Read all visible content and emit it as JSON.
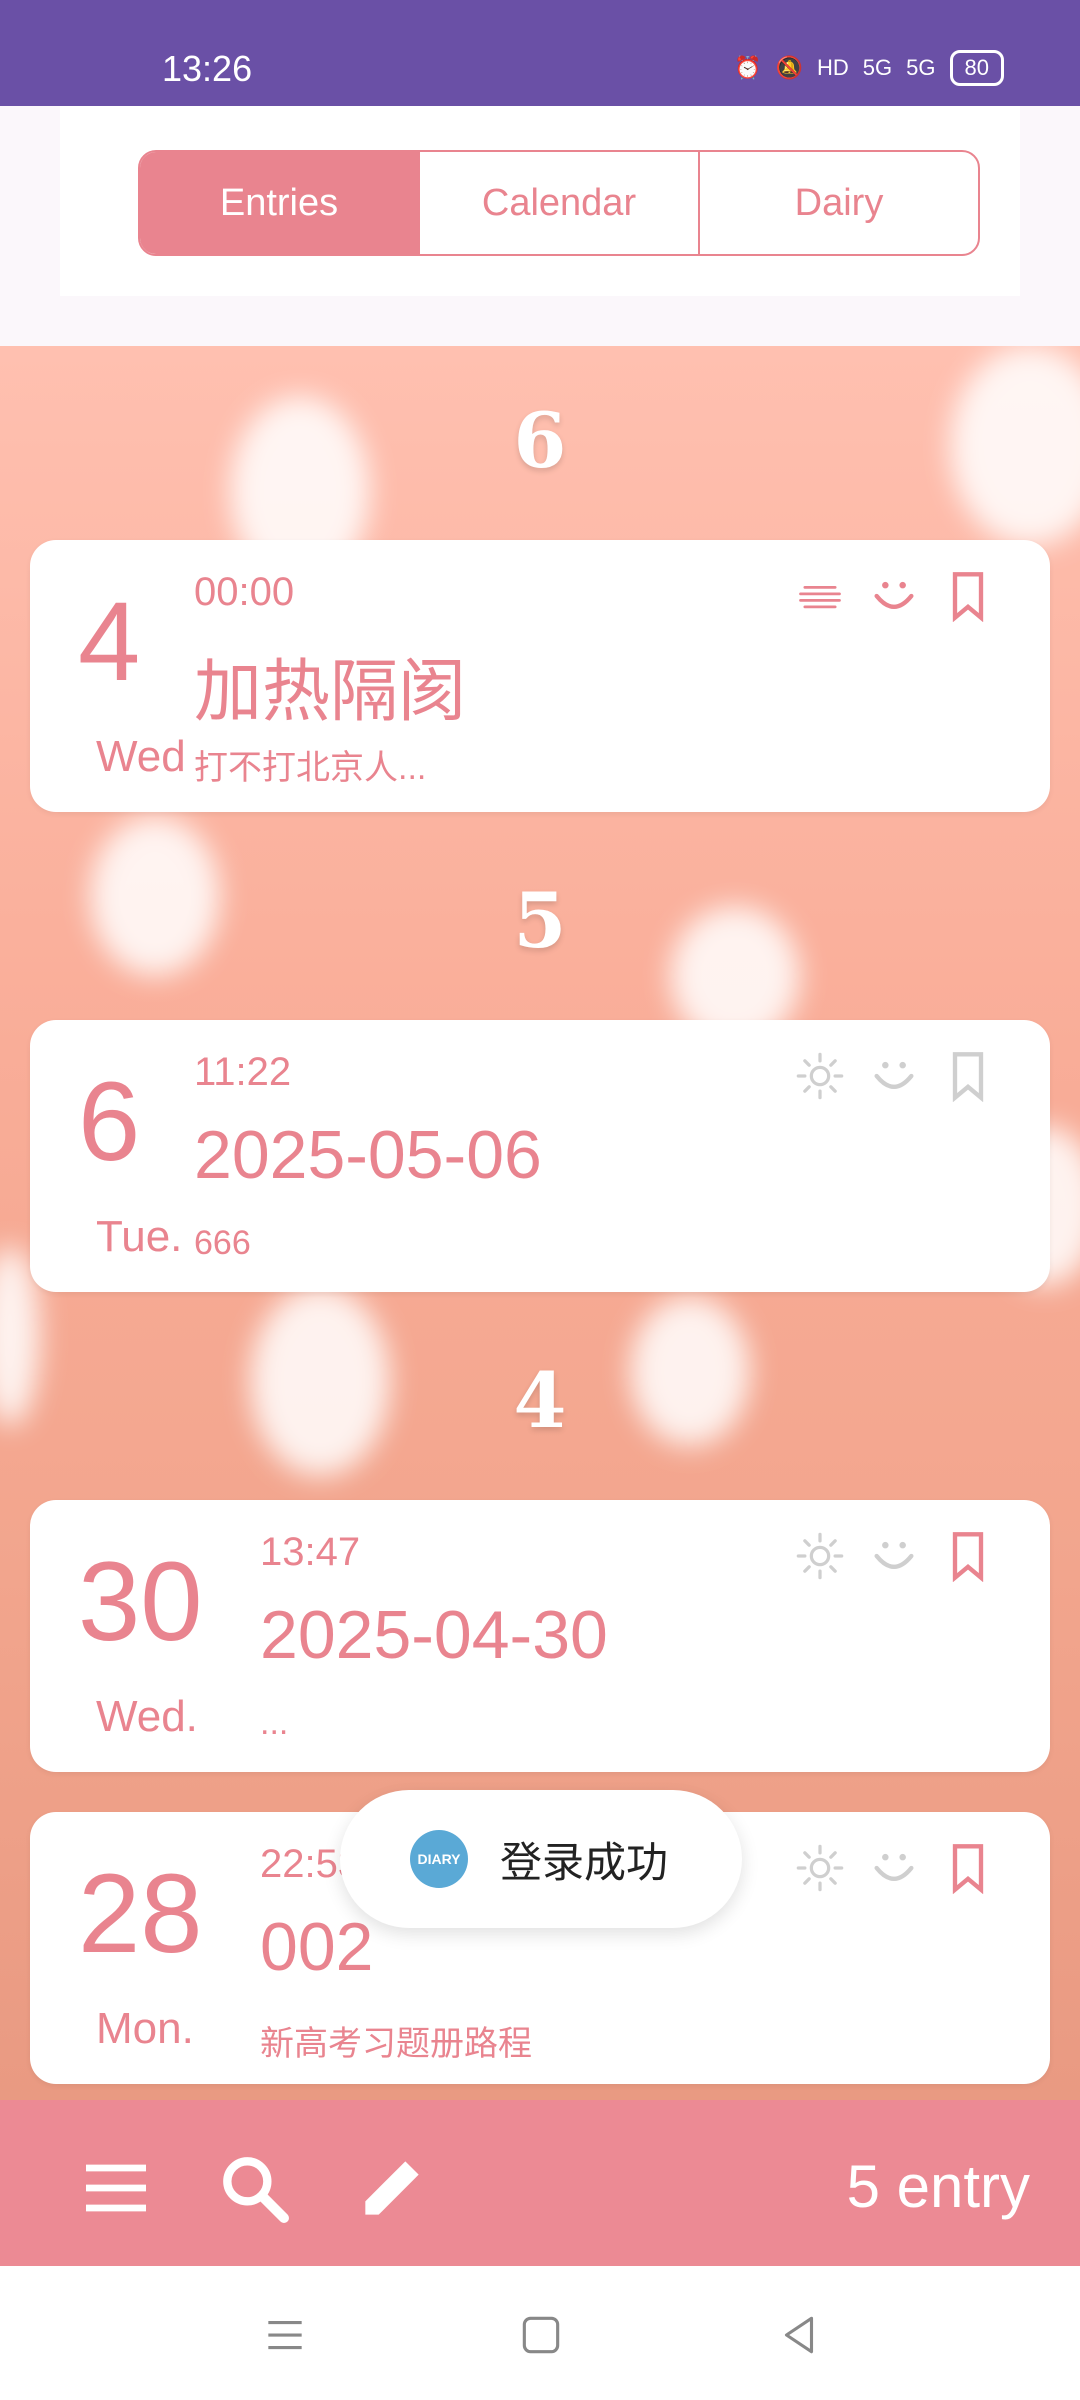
{
  "status_bar": {
    "time": "13:26",
    "signal_1": "5G",
    "signal_2": "5G",
    "hd_badge": "HD",
    "battery": "80"
  },
  "tabs": [
    {
      "label": "Entries",
      "active": true
    },
    {
      "label": "Calendar",
      "active": false
    },
    {
      "label": "Dairy",
      "active": false
    }
  ],
  "groups": [
    {
      "month": "6",
      "entries": [
        {
          "day": "4",
          "weekday": "Wed",
          "time": "00:00",
          "title": "加热隔阂",
          "excerpt": "打不打北京人...",
          "weather_icon": "haze-icon",
          "mood_icon": "smile-icon",
          "bookmarked": true
        }
      ]
    },
    {
      "month": "5",
      "entries": [
        {
          "day": "6",
          "weekday": "Tue.",
          "time": "11:22",
          "title": "2025-05-06",
          "excerpt": "666",
          "weather_icon": "sun-icon",
          "mood_icon": "smile-icon",
          "bookmarked": false
        }
      ]
    },
    {
      "month": "4",
      "entries": [
        {
          "day": "30",
          "weekday": "Wed.",
          "time": "13:47",
          "title": "2025-04-30",
          "excerpt": "...",
          "weather_icon": "sun-icon",
          "mood_icon": "smile-icon",
          "bookmarked": true
        },
        {
          "day": "28",
          "weekday": "Mon.",
          "time": "22:53",
          "title": "002",
          "excerpt": "新高考习题册路程",
          "weather_icon": "sun-icon",
          "mood_icon": "smile-icon",
          "bookmarked": true
        }
      ]
    }
  ],
  "toast": {
    "message": "登录成功",
    "app_icon_text": "DIARY"
  },
  "bottom_bar": {
    "count_label": "5  entry"
  },
  "colors": {
    "accent": "#e9848f",
    "status_bar": "#6a50a6",
    "bottom_bar": "#ec8a94"
  }
}
